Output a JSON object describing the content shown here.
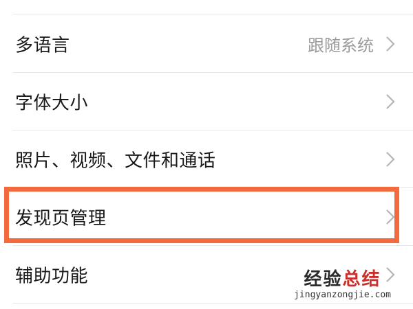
{
  "settings": {
    "rows": [
      {
        "label": "多语言",
        "value": "跟随系统"
      },
      {
        "label": "字体大小",
        "value": ""
      },
      {
        "label": "照片、视频、文件和通话",
        "value": ""
      },
      {
        "label": "发现页管理",
        "value": ""
      },
      {
        "label": "辅助功能",
        "value": ""
      }
    ],
    "icons": {
      "chevron": "chevron-right-icon"
    }
  },
  "annotation": {
    "highlighted_row": "发现页管理",
    "color": "#f26a3d"
  },
  "watermark": {
    "text_part1": "经验",
    "text_part2": "总结",
    "url": "jingyanzongjie.com"
  },
  "colors": {
    "label": "#191919",
    "value": "#9a9a9a",
    "divider": "#e7e7e7",
    "chevron": "#b5b5b5"
  }
}
